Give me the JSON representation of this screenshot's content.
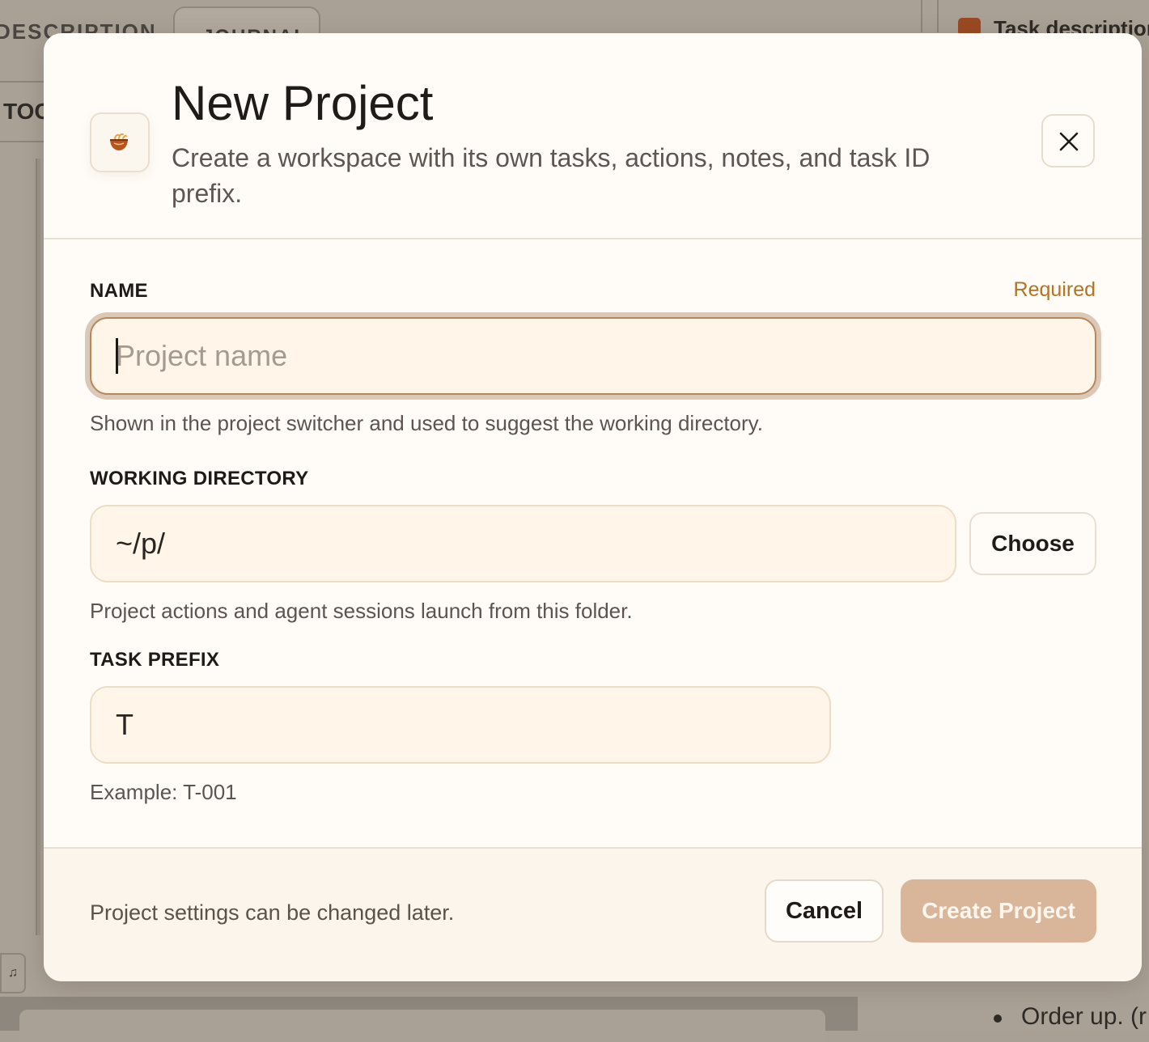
{
  "background": {
    "tab_description": "DESCRIPTION",
    "tab_journal": "JOURNAL",
    "toc": "TOC",
    "task_title": "Task description",
    "order_text": "Order up. (r",
    "bell_icon": "bell-icon"
  },
  "modal": {
    "icon": "bowl-icon",
    "title": "New Project",
    "subtitle": "Create a workspace with its own tasks, actions, notes, and task ID prefix.",
    "close_icon": "close-icon",
    "name": {
      "label": "NAME",
      "required": "Required",
      "value": "",
      "placeholder": "Project name",
      "help": "Shown in the project switcher and used to suggest the working directory."
    },
    "working_directory": {
      "label": "WORKING DIRECTORY",
      "value": "~/p/",
      "choose_label": "Choose",
      "help": "Project actions and agent sessions launch from this folder."
    },
    "task_prefix": {
      "label": "TASK PREFIX",
      "value": "T",
      "help": "Example: T-001"
    },
    "footer": {
      "note": "Project settings can be changed later.",
      "cancel_label": "Cancel",
      "create_label": "Create Project"
    }
  },
  "colors": {
    "accent": "#b07424",
    "primary_disabled": "#d9b69a",
    "input_bg": "#fff6e9",
    "modal_bg": "#fffcf7"
  }
}
